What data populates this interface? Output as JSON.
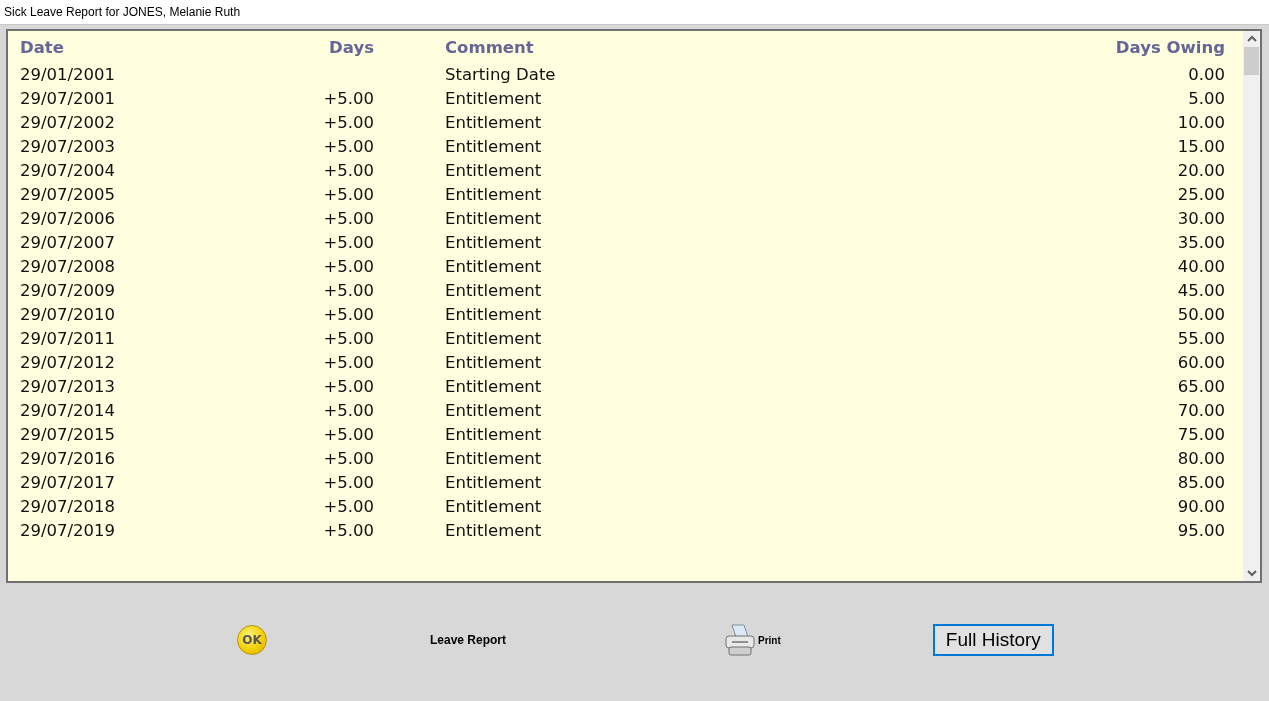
{
  "window": {
    "title": "Sick Leave Report for JONES, Melanie Ruth"
  },
  "table": {
    "columns": [
      "Date",
      "Days",
      "Comment",
      "Days Owing"
    ],
    "rows": [
      [
        "29/01/2001",
        "",
        "Starting Date",
        "0.00"
      ],
      [
        "29/07/2001",
        "+5.00",
        "Entitlement",
        "5.00"
      ],
      [
        "29/07/2002",
        "+5.00",
        "Entitlement",
        "10.00"
      ],
      [
        "29/07/2003",
        "+5.00",
        "Entitlement",
        "15.00"
      ],
      [
        "29/07/2004",
        "+5.00",
        "Entitlement",
        "20.00"
      ],
      [
        "29/07/2005",
        "+5.00",
        "Entitlement",
        "25.00"
      ],
      [
        "29/07/2006",
        "+5.00",
        "Entitlement",
        "30.00"
      ],
      [
        "29/07/2007",
        "+5.00",
        "Entitlement",
        "35.00"
      ],
      [
        "29/07/2008",
        "+5.00",
        "Entitlement",
        "40.00"
      ],
      [
        "29/07/2009",
        "+5.00",
        "Entitlement",
        "45.00"
      ],
      [
        "29/07/2010",
        "+5.00",
        "Entitlement",
        "50.00"
      ],
      [
        "29/07/2011",
        "+5.00",
        "Entitlement",
        "55.00"
      ],
      [
        "29/07/2012",
        "+5.00",
        "Entitlement",
        "60.00"
      ],
      [
        "29/07/2013",
        "+5.00",
        "Entitlement",
        "65.00"
      ],
      [
        "29/07/2014",
        "+5.00",
        "Entitlement",
        "70.00"
      ],
      [
        "29/07/2015",
        "+5.00",
        "Entitlement",
        "75.00"
      ],
      [
        "29/07/2016",
        "+5.00",
        "Entitlement",
        "80.00"
      ],
      [
        "29/07/2017",
        "+5.00",
        "Entitlement",
        "85.00"
      ],
      [
        "29/07/2018",
        "+5.00",
        "Entitlement",
        "90.00"
      ],
      [
        "29/07/2019",
        "+5.00",
        "Entitlement",
        "95.00"
      ]
    ]
  },
  "footer": {
    "ok_button": "OK",
    "report_label": "Leave Report",
    "print_button": "Print",
    "history_button": "Full History"
  }
}
